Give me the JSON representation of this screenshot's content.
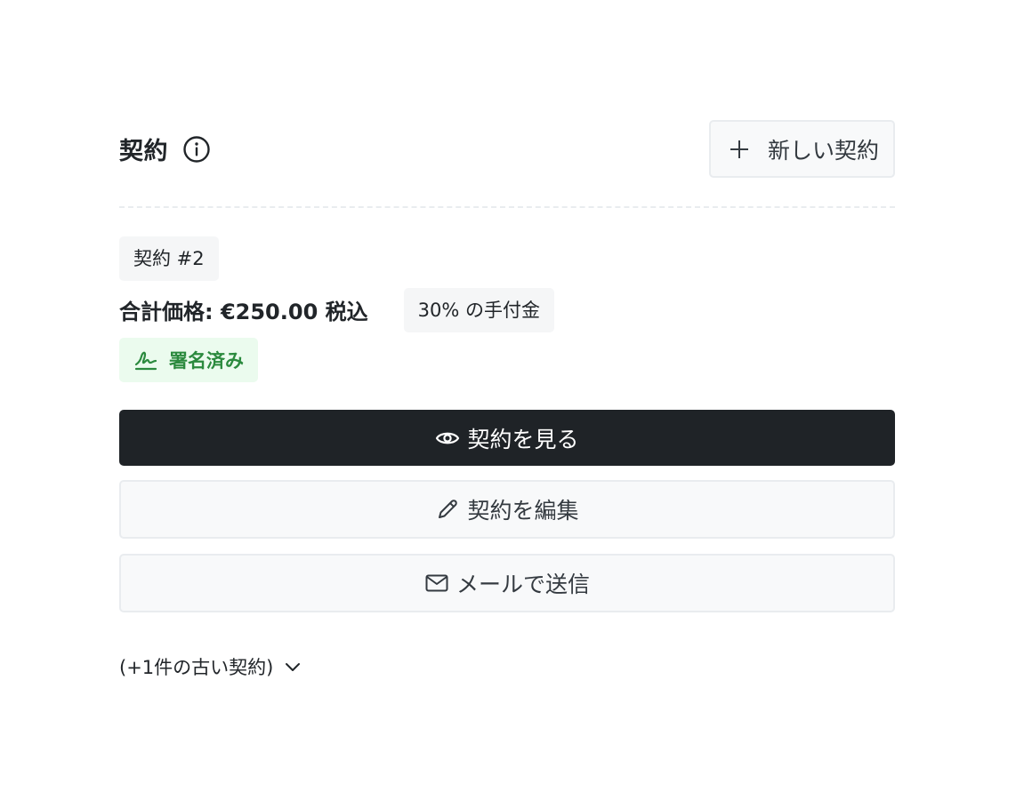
{
  "section": {
    "title": "契約",
    "new_button_label": "新しい契約"
  },
  "contract": {
    "number_badge": "契約 #2",
    "total_price": "合計価格: €250.00 税込",
    "deposit_badge": "30% の手付金",
    "status_badge": "署名済み"
  },
  "actions": {
    "view_label": "契約を見る",
    "edit_label": "契約を編集",
    "email_label": "メールで送信"
  },
  "older": {
    "label": "(+1件の古い契約)"
  },
  "colors": {
    "primary_dark": "#1f2327",
    "signed_text": "#2b8a3e",
    "signed_bg": "#ebfbee",
    "neutral_bg": "#f8f9fa",
    "border": "#e9ecef"
  },
  "icons": {
    "info": "info-icon",
    "plus": "plus-icon",
    "signature": "signature-icon",
    "eye": "eye-icon",
    "pencil": "pencil-icon",
    "mail": "mail-icon",
    "chevron": "chevron-down-icon"
  }
}
